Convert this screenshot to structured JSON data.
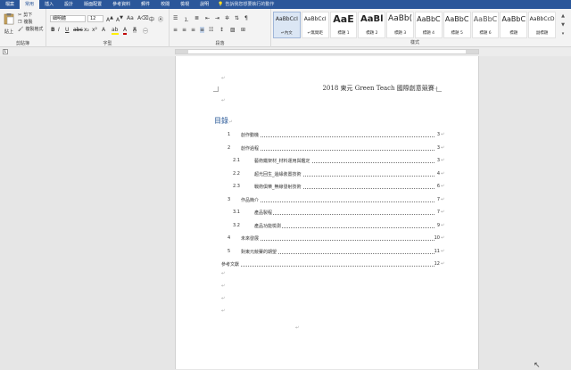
{
  "tabs": [
    {
      "label": "檔案"
    },
    {
      "label": "常用"
    },
    {
      "label": "插入"
    },
    {
      "label": "設計"
    },
    {
      "label": "版面配置"
    },
    {
      "label": "參考資料"
    },
    {
      "label": "郵件"
    },
    {
      "label": "校閱"
    },
    {
      "label": "檢視"
    },
    {
      "label": "說明"
    }
  ],
  "tell_me": "告訴我您想要執行的動作",
  "ribbon": {
    "clipboard": {
      "paste": "貼上",
      "cut": "剪下",
      "copy": "複製",
      "format_painter": "複製格式",
      "label": "剪貼簿"
    },
    "font": {
      "name": "細明體",
      "size": "12",
      "label": "字型"
    },
    "paragraph": {
      "label": "段落"
    },
    "styles": {
      "label": "樣式",
      "items": [
        {
          "preview": "AaBbCcI",
          "name": "↵內文"
        },
        {
          "preview": "AaBbCcI",
          "name": "↵無間距"
        },
        {
          "preview": "AaE",
          "name": "標題 1"
        },
        {
          "preview": "AaBl",
          "name": "標題 2"
        },
        {
          "preview": "AaBb(",
          "name": "標題 3"
        },
        {
          "preview": "AaBbC",
          "name": "標題 4"
        },
        {
          "preview": "AaBbC",
          "name": "標題 5"
        },
        {
          "preview": "AaBbC",
          "name": "標題 6"
        },
        {
          "preview": "AaBbC",
          "name": "標題"
        },
        {
          "preview": "AaBbCcD",
          "name": "副標題"
        }
      ]
    }
  },
  "document": {
    "header": "2018 東元 Green Teach 國際創意競賽",
    "toc_title": "目錄",
    "toc": [
      {
        "num": "1",
        "text": "創作動機",
        "page": "3"
      },
      {
        "num": "2",
        "text": "創作過程",
        "page": "3"
      },
      {
        "num": "2.1",
        "text": "藝術鐵架材_材料運用與鑑定",
        "page": "3"
      },
      {
        "num": "2.2",
        "text": "超光回生_邊緣裝置技術",
        "page": "4"
      },
      {
        "num": "2.3",
        "text": "戰術俱樂_無線發射技術",
        "page": "6"
      },
      {
        "num": "3",
        "text": "作品簡介",
        "page": "7"
      },
      {
        "num": "3.1",
        "text": "產品製程",
        "page": "7"
      },
      {
        "num": "3.2",
        "text": "產品功能檢測",
        "page": "9"
      },
      {
        "num": "4",
        "text": "未來發展",
        "page": "10"
      },
      {
        "num": "5",
        "text": "對東元競賽的期望",
        "page": "11"
      },
      {
        "num": "",
        "text": "參考文獻",
        "page": "12"
      }
    ]
  }
}
